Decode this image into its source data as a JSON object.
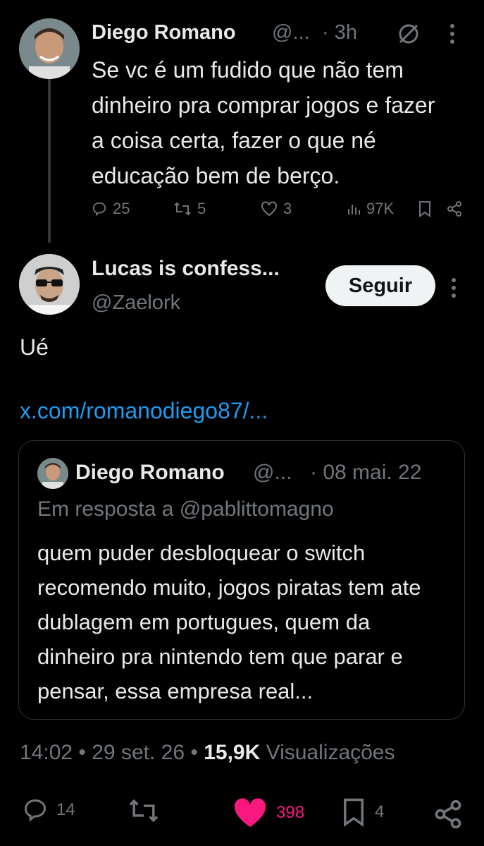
{
  "parent_tweet": {
    "author_name": "Diego Romano",
    "handle_truncated": "@...",
    "time": "· 3h",
    "text": "Se vc é um fudido que não tem dinheiro pra comprar jogos e fazer a coisa certa, fazer o que né educação bem de berço.",
    "replies": "25",
    "retweets": "5",
    "likes": "3",
    "views": "97K"
  },
  "main_tweet": {
    "author_name": "Lucas is confess...",
    "handle": "@Zaelork",
    "follow_label": "Seguir",
    "text": "Ué",
    "link": "x.com/romanodiego87/...",
    "timestamp": "14:02 • 29 set. 26 •",
    "views_count": "15,9K",
    "views_label": "Visualizações",
    "replies": "14",
    "retweets": "",
    "likes": "398",
    "bookmarks": "4"
  },
  "quoted_tweet": {
    "author_name": "Diego Romano",
    "handle_truncated": "@...",
    "date": "· 08 mai. 22",
    "reply_to": "Em resposta a @pablittomagno",
    "text": "quem puder desbloquear o switch recomendo muito, jogos piratas tem ate dublagem em portugues, quem da dinheiro pra nintendo tem que parar e pensar, essa empresa real..."
  },
  "colors": {
    "background": "#000000",
    "text": "#e7e9ea",
    "muted": "#71767b",
    "link": "#1d9bf0",
    "like_active": "#f91880"
  }
}
